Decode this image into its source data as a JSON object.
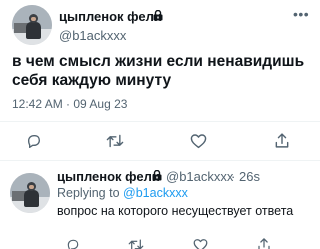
{
  "main_tweet": {
    "author_name": "цыпленок фели",
    "author_handle": "@b1ackxxx",
    "text": "в чем смысл жизни если ненавидишь себя каждую минуту",
    "timestamp": "12:42 AM · 09 Aug 23",
    "icons": [
      "avatar",
      "lock-icon",
      "more-icon",
      "reply-icon",
      "retweet-icon",
      "like-icon",
      "share-icon"
    ]
  },
  "reply_tweet": {
    "author_name": "цыпленок фели",
    "author_handle": "@b1ackxxx",
    "separator": "·",
    "time_ago": "26s",
    "replying_prefix": "Replying to",
    "replying_to": "@b1ackxxx",
    "text": "вопрос на которого несуществует ответа",
    "icons": [
      "avatar",
      "lock-icon",
      "reply-icon",
      "retweet-icon",
      "like-icon",
      "share-icon"
    ]
  }
}
